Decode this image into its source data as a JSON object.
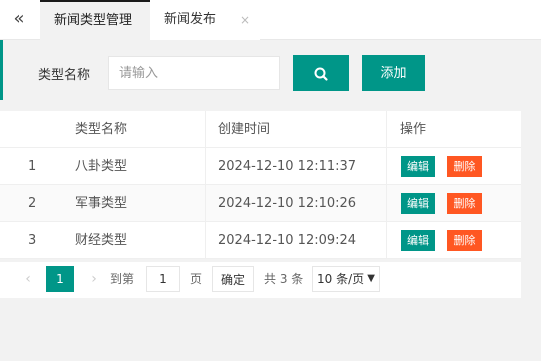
{
  "tabs": [
    {
      "label": "新闻类型管理",
      "active": true
    },
    {
      "label": "新闻发布",
      "active": false
    }
  ],
  "tab_close_icon": "×",
  "collapse_icon": "«",
  "search": {
    "label": "类型名称",
    "placeholder": "请输入",
    "search_icon": "search-icon",
    "add_label": "添加"
  },
  "table": {
    "headers": [
      "类型名称",
      "创建时间",
      "操作"
    ],
    "rows": [
      {
        "index": "1",
        "name": "八卦类型",
        "created": "2024-12-10 12:11:37"
      },
      {
        "index": "2",
        "name": "军事类型",
        "created": "2024-12-10 12:10:26"
      },
      {
        "index": "3",
        "name": "财经类型",
        "created": "2024-12-10 12:09:24"
      }
    ],
    "edit_label": "编辑",
    "delete_label": "删除"
  },
  "pager": {
    "prev": "‹",
    "current": "1",
    "next": "›",
    "goto_label": "到第",
    "goto_value": "1",
    "page_label": "页",
    "confirm_label": "确定",
    "total_label": "共 3 条",
    "page_size": "10 条/页"
  },
  "colors": {
    "accent": "#009688",
    "danger": "#ff5722"
  }
}
